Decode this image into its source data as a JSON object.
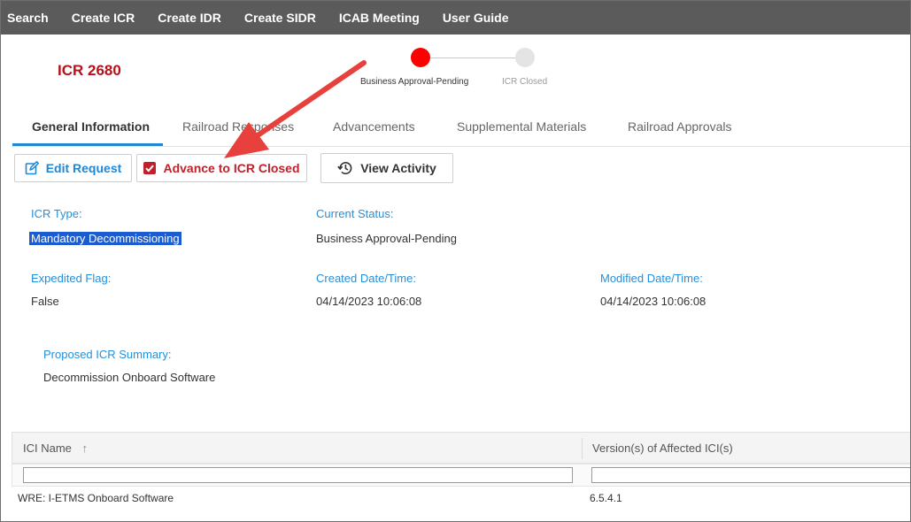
{
  "nav": {
    "items": [
      "Search",
      "Create ICR",
      "Create IDR",
      "Create SIDR",
      "ICAB Meeting",
      "User Guide"
    ]
  },
  "record": {
    "id": "ICR 2680"
  },
  "stepper": {
    "steps": [
      {
        "label": "Business Approval-Pending",
        "state": "active",
        "color": "#ff0000"
      },
      {
        "label": "ICR Closed",
        "state": "inactive",
        "color": "#e4e4e4"
      }
    ]
  },
  "tabs": [
    {
      "label": "General Information",
      "selected": true
    },
    {
      "label": "Railroad Responses",
      "selected": false
    },
    {
      "label": "Advancements",
      "selected": false
    },
    {
      "label": "Supplemental Materials",
      "selected": false
    },
    {
      "label": "Railroad Approvals",
      "selected": false
    }
  ],
  "actions": {
    "edit": {
      "label": "Edit Request",
      "icon": "edit-icon"
    },
    "advance": {
      "label": "Advance to ICR Closed",
      "icon": "checkbox-checked-icon"
    },
    "activity": {
      "label": "View Activity",
      "icon": "history-icon"
    }
  },
  "details": {
    "icr_type": {
      "label": "ICR Type:",
      "value": "Mandatory Decommissioning"
    },
    "current_status": {
      "label": "Current Status:",
      "value": "Business Approval-Pending"
    },
    "expedited_flag": {
      "label": "Expedited Flag:",
      "value": "False"
    },
    "created": {
      "label": "Created Date/Time:",
      "value": "04/14/2023 10:06:08"
    },
    "modified": {
      "label": "Modified Date/Time:",
      "value": "04/14/2023 10:06:08"
    },
    "summary": {
      "label": "Proposed ICR Summary:",
      "value": "Decommission Onboard Software"
    }
  },
  "grid": {
    "columns": [
      {
        "label": "ICI Name",
        "sort_icon": "↑"
      },
      {
        "label": "Version(s) of Affected ICI(s)"
      }
    ],
    "rows": [
      {
        "name": "WRE: I-ETMS Onboard Software",
        "version": "6.5.4.1"
      }
    ]
  },
  "colors": {
    "nav_bg": "#5b5b5b",
    "accent_blue": "#1e88d6",
    "record_red": "#b5111b",
    "annotation_arrow": "#e8413d"
  }
}
